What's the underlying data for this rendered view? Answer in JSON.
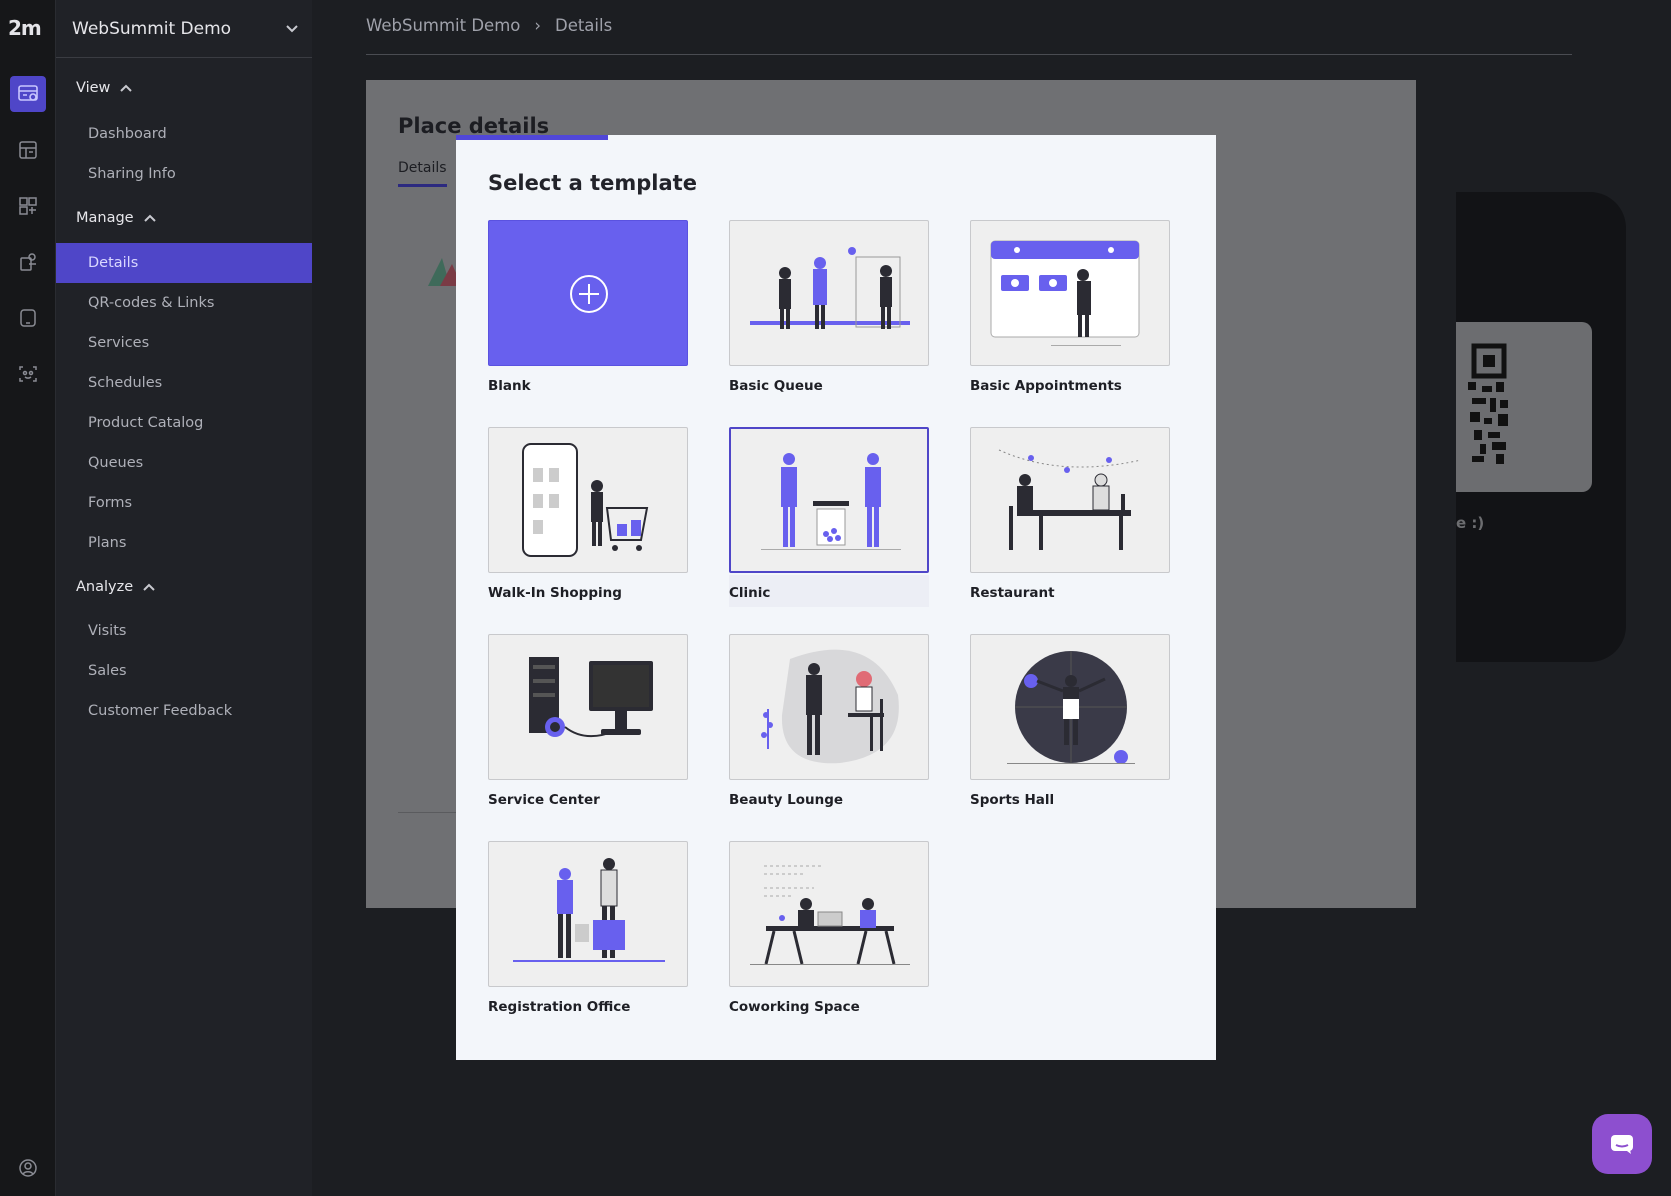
{
  "app": {
    "name": "WebSummit Demo",
    "logo_text": "2m"
  },
  "sidebar": {
    "sections": [
      {
        "label": "View",
        "items": [
          "Dashboard",
          "Sharing Info"
        ]
      },
      {
        "label": "Manage",
        "items": [
          "Details",
          "QR-codes & Links",
          "Services",
          "Schedules",
          "Product Catalog",
          "Queues",
          "Forms",
          "Plans"
        ]
      },
      {
        "label": "Analyze",
        "items": [
          "Visits",
          "Sales",
          "Customer Feedback"
        ]
      }
    ],
    "active_item": "Details"
  },
  "breadcrumb": {
    "root": "WebSummit Demo",
    "current": "Details",
    "separator": "›"
  },
  "card": {
    "title": "Place details",
    "tab": "Details",
    "partial_text": "e :)"
  },
  "modal": {
    "title": "Select a template",
    "progress_fraction": 0.2,
    "templates": [
      {
        "label": "Blank"
      },
      {
        "label": "Basic Queue"
      },
      {
        "label": "Basic Appointments"
      },
      {
        "label": "Walk-In Shopping"
      },
      {
        "label": "Clinic"
      },
      {
        "label": "Restaurant"
      },
      {
        "label": "Service Center"
      },
      {
        "label": "Beauty Lounge"
      },
      {
        "label": "Sports Hall"
      },
      {
        "label": "Registration Office"
      },
      {
        "label": "Coworking Space"
      }
    ],
    "selected_template": "Clinic"
  },
  "colors": {
    "accent": "#4f46c8",
    "blank_tile": "#6860ee",
    "chat": "#8d4fcf"
  }
}
